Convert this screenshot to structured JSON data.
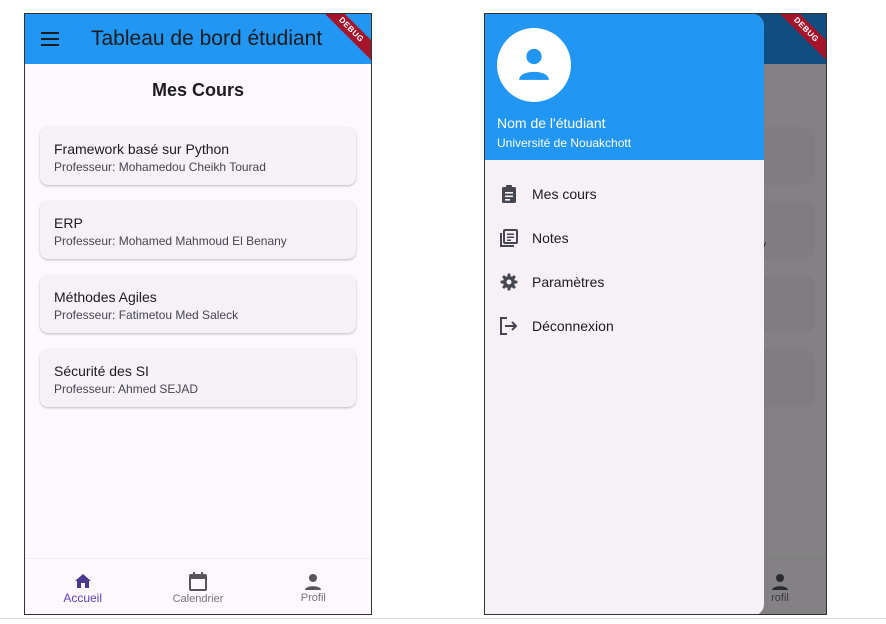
{
  "left_screen": {
    "appbar": {
      "title": "Tableau de bord étudiant",
      "menu_icon": "menu-icon"
    },
    "debug_banner": "DEBUG",
    "section_title": "Mes Cours",
    "courses": [
      {
        "title": "Framework basé sur Python",
        "professor": "Professeur: Mohamedou Cheikh Tourad"
      },
      {
        "title": "ERP",
        "professor": "Professeur: Mohamed Mahmoud El Benany"
      },
      {
        "title": "Méthodes Agiles",
        "professor": "Professeur: Fatimetou Med Saleck"
      },
      {
        "title": "Sécurité des SI",
        "professor": "Professeur: Ahmed SEJAD"
      }
    ],
    "bottom_nav": [
      {
        "label": "Accueil",
        "icon": "home-icon",
        "active": true
      },
      {
        "label": "Calendrier",
        "icon": "calendar-icon",
        "active": false
      },
      {
        "label": "Profil",
        "icon": "person-icon",
        "active": false
      }
    ]
  },
  "right_screen": {
    "debug_banner": "DEBUG",
    "background": {
      "title_fragment": "t",
      "text_fragment": "y",
      "nav_label_fragment": "rofil"
    },
    "drawer": {
      "student_name": "Nom de l'étudiant",
      "university": "Université de Nouakchott",
      "items": [
        {
          "label": "Mes cours",
          "icon": "assignment-icon"
        },
        {
          "label": "Notes",
          "icon": "library-books-icon"
        },
        {
          "label": "Paramètres",
          "icon": "settings-icon"
        },
        {
          "label": "Déconnexion",
          "icon": "logout-icon"
        }
      ]
    }
  },
  "colors": {
    "appbar": "#2196f3",
    "active_nav": "#5e3fb7",
    "background": "#fdf7fe",
    "card": "#f6f0f7",
    "debug": "#a5142a"
  }
}
